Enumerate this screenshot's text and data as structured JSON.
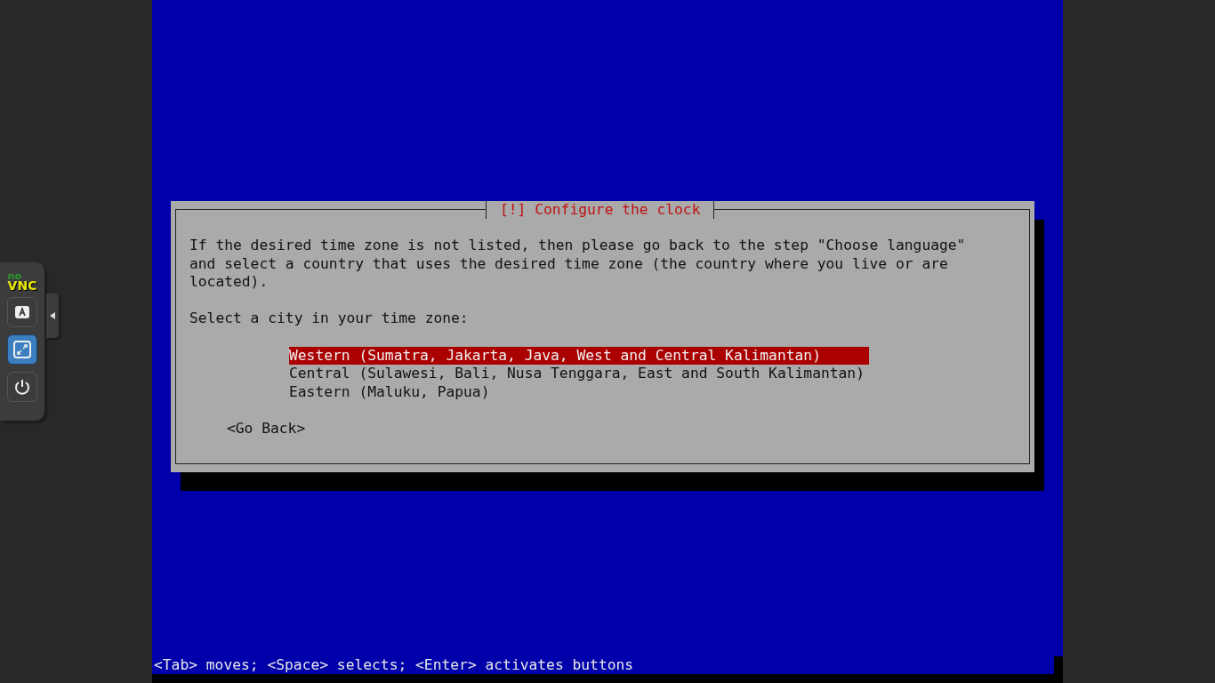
{
  "vnc_panel": {
    "logo_no": "no",
    "logo_vnc": "VNC",
    "buttons": [
      {
        "kind": "keyboard",
        "selected": false
      },
      {
        "kind": "fullscreen",
        "selected": true
      },
      {
        "kind": "power",
        "selected": false
      }
    ]
  },
  "dialog": {
    "title": "[!] Configure the clock",
    "message": [
      "If the desired time zone is not listed, then please go back to the step \"Choose language\"",
      "and select a country that uses the desired time zone (the country where you live or are",
      "located)."
    ],
    "prompt": "Select a city in your time zone:",
    "items": [
      {
        "label": "Western (Sumatra, Jakarta, Java, West and Central Kalimantan)",
        "selected": true
      },
      {
        "label": "Central (Sulawesi, Bali, Nusa Tenggara, East and South Kalimantan)",
        "selected": false
      },
      {
        "label": "Eastern (Maluku, Papua)",
        "selected": false
      }
    ],
    "back_button": "<Go Back>"
  },
  "status_bar": "<Tab> moves; <Space> selects; <Enter> activates buttons"
}
